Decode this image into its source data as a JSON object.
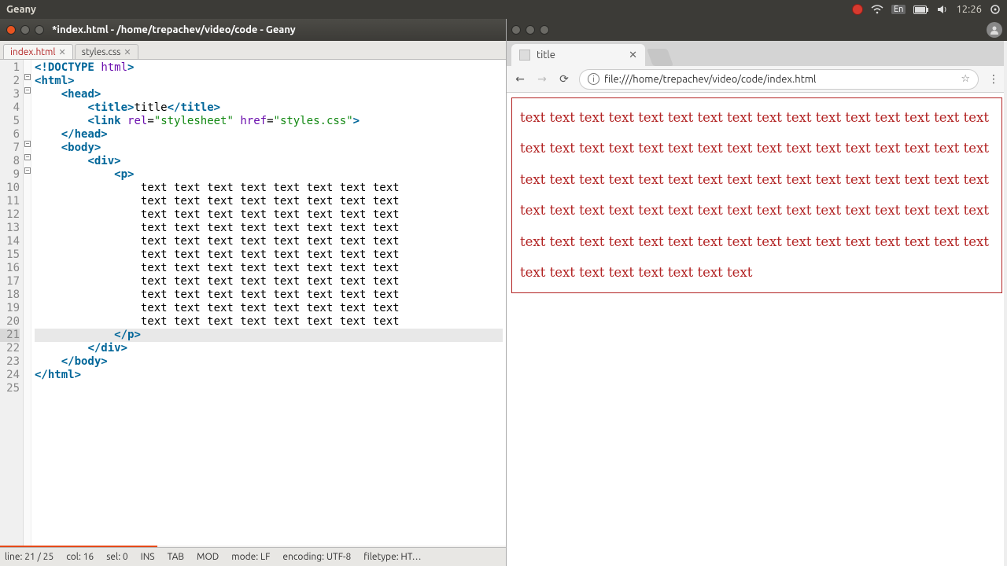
{
  "system": {
    "app_label": "Geany",
    "lang": "En",
    "clock": "12:26"
  },
  "geany": {
    "window_title": "*index.html - /home/trepachev/video/code - Geany",
    "tabs": [
      {
        "label": "index.html",
        "active": true
      },
      {
        "label": "styles.css",
        "active": false
      }
    ],
    "status": {
      "line": "line: 21 / 25",
      "col": "col: 16",
      "sel": "sel: 0",
      "ins": "INS",
      "tab": "TAB",
      "mod": "MOD",
      "mode": "mode: LF",
      "encoding": "encoding: UTF-8",
      "filetype": "filetype: HT…"
    },
    "code": {
      "l1_doctype": "DOCTYPE",
      "l1_html": "html",
      "tag_html": "html",
      "tag_head": "head",
      "tag_title": "title",
      "title_text": "title",
      "tag_link": "link",
      "attr_rel": "rel",
      "val_rel": "\"stylesheet\"",
      "attr_href": "href",
      "val_href": "\"styles.css\"",
      "tag_body": "body",
      "tag_div": "div",
      "tag_p": "p",
      "text_row": "text text text text text text text text"
    }
  },
  "browser": {
    "tab_title": "title",
    "url": "file:///home/trepachev/video/code/index.html",
    "paragraphs": [
      "text text text text text text text text text text text text text text text text",
      "text text text text text text text text text text text text text text text text",
      "text text text text text text text text text text text text text text text text",
      "text text text text text text text text text text text text text text text text",
      "text text text text text text text text text text text text text text text text",
      "text text text text text text text text"
    ]
  }
}
